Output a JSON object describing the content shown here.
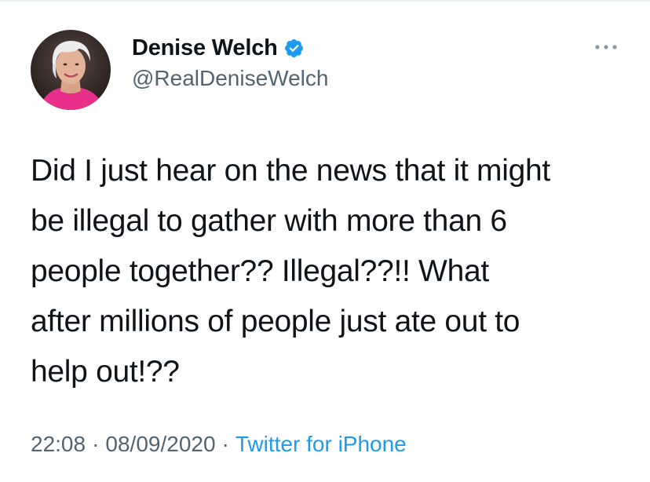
{
  "tweet": {
    "author": {
      "display_name": "Denise Welch",
      "handle": "@RealDeniseWelch",
      "verified": true
    },
    "text": "Did I just hear on the news that it might\nbe illegal to gather with more than 6\npeople together?? Illegal??!! What\nafter millions of people just ate out to\nhelp out!??",
    "time": "22:08",
    "separator": "·",
    "date": "08/09/2020",
    "source": "Twitter for iPhone"
  },
  "icons": {
    "verified": "verified-badge-icon",
    "more": "more-options-icon",
    "avatar": "profile-photo"
  },
  "colors": {
    "accent": "#1d9bf0",
    "muted": "#536471",
    "text": "#0f1419"
  }
}
